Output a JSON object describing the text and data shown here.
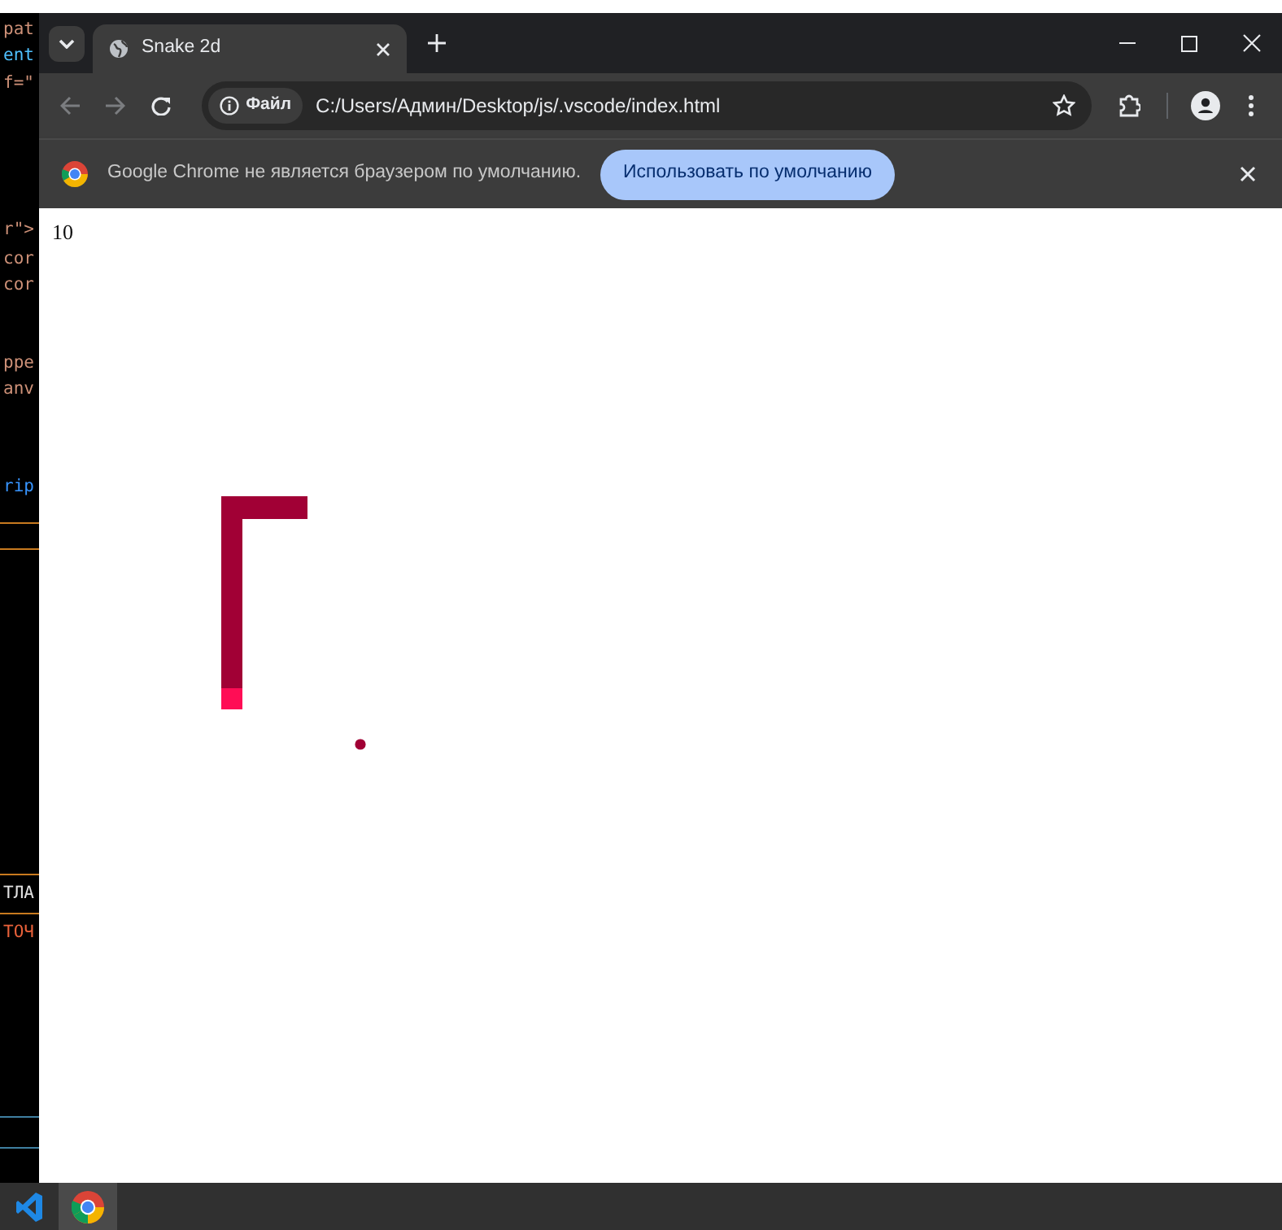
{
  "background_editor": {
    "lines": [
      {
        "text": "pat",
        "color": "#ce9178"
      },
      {
        "text": "ent",
        "color": "#4fc1ff"
      },
      {
        "text": "f=\"",
        "color": "#ce9178"
      },
      {
        "text": "r\">",
        "color": "#ce9178"
      },
      {
        "text": "cor",
        "color": "#ce9178"
      },
      {
        "text": "cor",
        "color": "#ce9178"
      },
      {
        "text": "ppe",
        "color": "#ce9178"
      },
      {
        "text": "anv",
        "color": "#ce9178"
      },
      {
        "text": "rip",
        "color": "#3794ff"
      },
      {
        "text": "ТЛА",
        "color": "#e0e0e0"
      },
      {
        "text": "ТОЧ",
        "color": "#e8613a"
      }
    ]
  },
  "browser": {
    "tabs": [
      {
        "title": "Snake 2d",
        "selected": true
      }
    ],
    "address": {
      "badge": "Файл",
      "url": "C:/Users/Админ/Desktop/js/.vscode/index.html"
    },
    "infobar": {
      "message": "Google Chrome не является браузером по умолчанию.",
      "button": "Использовать по умолчанию"
    }
  },
  "page": {
    "score": "10"
  },
  "taskbar": {
    "apps": [
      {
        "kind": "vscode",
        "selected": false
      },
      {
        "kind": "chrome",
        "selected": true
      }
    ]
  }
}
